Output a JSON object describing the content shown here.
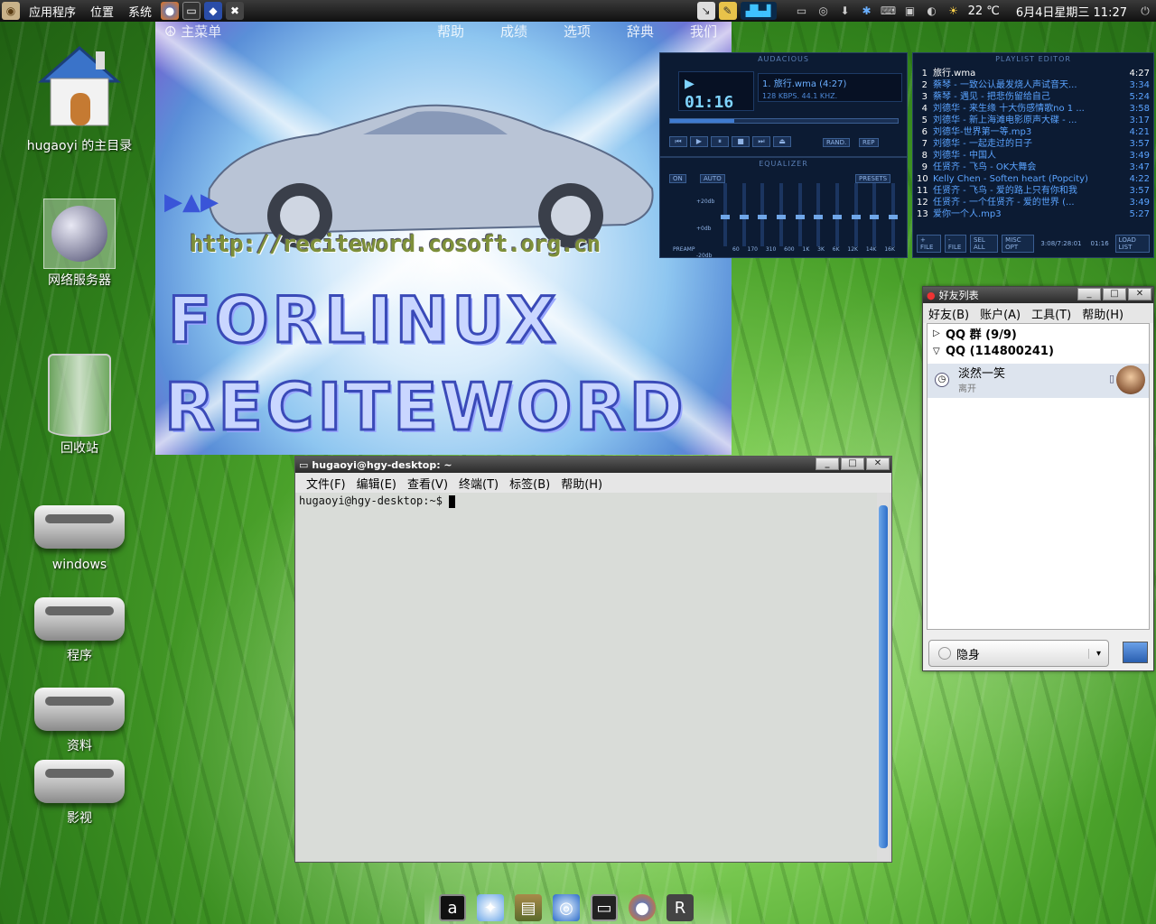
{
  "top_panel": {
    "menus": [
      "应用程序",
      "位置",
      "系统"
    ],
    "weather": "22 ℃",
    "clock": "6月4日星期三 11:27"
  },
  "desktop": {
    "home": "hugaoyi 的主目录",
    "network": "网络服务器",
    "trash": "回收站",
    "drive1": "windows",
    "drive2": "程序",
    "drive3": "资料",
    "drive4": "影视"
  },
  "reciteword": {
    "menu": [
      "主菜单",
      "帮助",
      "成绩",
      "选项",
      "辞典",
      "我们"
    ],
    "url": "http://reciteword.cosoft.org.cn",
    "word1": "FORLINUX",
    "word2": "RECITEWORD"
  },
  "audacious": {
    "title": "AUDACIOUS",
    "time": "01:16",
    "track": "1. 旅行.wma (4:27)",
    "bitrate": "128 KBPS. 44.1 KHZ.",
    "eq_title": "EQUALIZER",
    "eq_on": "ON",
    "eq_auto": "AUTO",
    "eq_presets": "PRESETS",
    "eq_db": [
      "+20db",
      "+0db",
      "-20db"
    ],
    "eq_preamp": "PREAMP",
    "eq_bands": [
      "60",
      "170",
      "310",
      "600",
      "1K",
      "3K",
      "6K",
      "12K",
      "14K",
      "16K"
    ],
    "playlist_title": "PLAYLIST EDITOR",
    "total": "3:08/7:28:01",
    "elapsed": "01:16",
    "playlist": [
      {
        "n": "1",
        "t": "旅行.wma",
        "d": "4:27"
      },
      {
        "n": "2",
        "t": "蔡琴 - 一致公认最发烧人声试音天...",
        "d": "3:34"
      },
      {
        "n": "3",
        "t": "蔡琴 - 遇见 - 把悲伤留给自己",
        "d": "5:24"
      },
      {
        "n": "4",
        "t": "刘德华 - 来生缘 十大伤感情歌no 1 ...",
        "d": "3:58"
      },
      {
        "n": "5",
        "t": "刘德华 - 新上海滩电影原声大碟 - ...",
        "d": "3:17"
      },
      {
        "n": "6",
        "t": "刘德华-世界第一等.mp3",
        "d": "4:21"
      },
      {
        "n": "7",
        "t": "刘德华 - 一起走过的日子",
        "d": "3:57"
      },
      {
        "n": "8",
        "t": "刘德华 - 中国人",
        "d": "3:49"
      },
      {
        "n": "9",
        "t": "任贤齐 - 飞鸟 - OK大舞会",
        "d": "3:47"
      },
      {
        "n": "10",
        "t": "Kelly Chen - Soften heart (Popcity)",
        "d": "4:22"
      },
      {
        "n": "11",
        "t": "任贤齐 - 飞鸟 - 爱的路上只有你和我",
        "d": "3:57"
      },
      {
        "n": "12",
        "t": "任贤齐 - 一个任贤齐 - 爱的世界 (...",
        "d": "3:49"
      },
      {
        "n": "13",
        "t": "爱你一个人.mp3",
        "d": "5:27"
      }
    ],
    "pl_buttons": [
      "+ FILE",
      "- FILE",
      "SEL ALL",
      "MISC OPT",
      "LOAD LIST"
    ]
  },
  "qq": {
    "title": "好友列表",
    "menu": [
      "好友(B)",
      "账户(A)",
      "工具(T)",
      "帮助(H)"
    ],
    "group1": "QQ 群 (9/9)",
    "group2": "QQ (114800241)",
    "friend_name": "淡然一笑",
    "friend_status": "离开",
    "my_status": "隐身"
  },
  "terminal": {
    "title": "hugaoyi@hgy-desktop: ~",
    "menu": [
      "文件(F)",
      "编辑(E)",
      "查看(V)",
      "终端(T)",
      "标签(B)",
      "帮助(H)"
    ],
    "prompt": "hugaoyi@hgy-desktop:~$ "
  }
}
